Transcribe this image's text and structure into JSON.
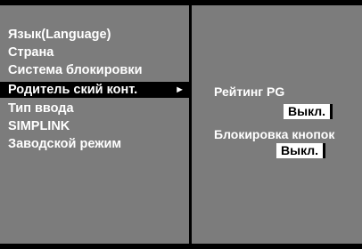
{
  "menu": {
    "items": [
      {
        "label": "Язык(Language)"
      },
      {
        "label": "Страна"
      },
      {
        "label": "Система блокировки"
      },
      {
        "label": "Родитель ский конт.",
        "selected": true,
        "arrow": "►"
      },
      {
        "label": "Тип ввода"
      },
      {
        "label": "SIMPLINK"
      },
      {
        "label": "Заводской режим"
      }
    ]
  },
  "submenu": {
    "pg_rating": {
      "label": "Рейтинг PG",
      "value": "Выкл."
    },
    "button_lock": {
      "label": "Блокировка кнопок",
      "value": "Выкл."
    }
  },
  "colors": {
    "panel": "#7c7c7c",
    "selected_bg": "#000000",
    "value_box": "#ffffff"
  }
}
